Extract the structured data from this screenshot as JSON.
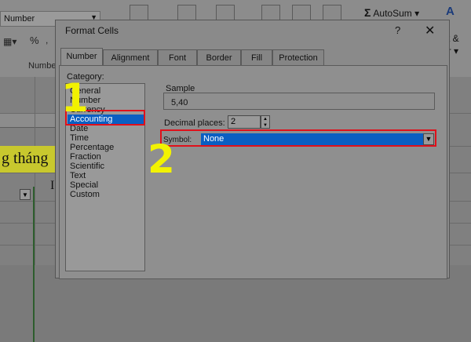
{
  "excel": {
    "font_box": "Number",
    "percent_symbol": "%",
    "group_label": "Numbe",
    "autosum_symbol": "Σ",
    "autosum": "AutoSum",
    "ribbon_right_top": "t &",
    "ribbon_right_bottom": "er ▾",
    "yellow_cell_text": "g tháng",
    "column_letter": "I"
  },
  "dialog": {
    "title": "Format Cells",
    "help": "?",
    "close": "✕",
    "tabs": [
      "Number",
      "Alignment",
      "Font",
      "Border",
      "Fill",
      "Protection"
    ],
    "category_label": "Category:",
    "categories": [
      "General",
      "Number",
      "Currency",
      "Accounting",
      "Date",
      "Time",
      "Percentage",
      "Fraction",
      "Scientific",
      "Text",
      "Special",
      "Custom"
    ],
    "selected_category": "Accounting",
    "sample_label": "Sample",
    "sample_value": "5,40",
    "decimal_label": "Decimal places:",
    "decimal_value": "2",
    "symbol_label": "Symbol:",
    "symbol_value": "None"
  },
  "annotations": {
    "step1": "1",
    "step2": "2"
  },
  "colors": {
    "selection": "#0a5fc2",
    "highlight_box": "#e0101a",
    "step_number": "#f2f200",
    "yellow_cell": "#c8c82e"
  }
}
